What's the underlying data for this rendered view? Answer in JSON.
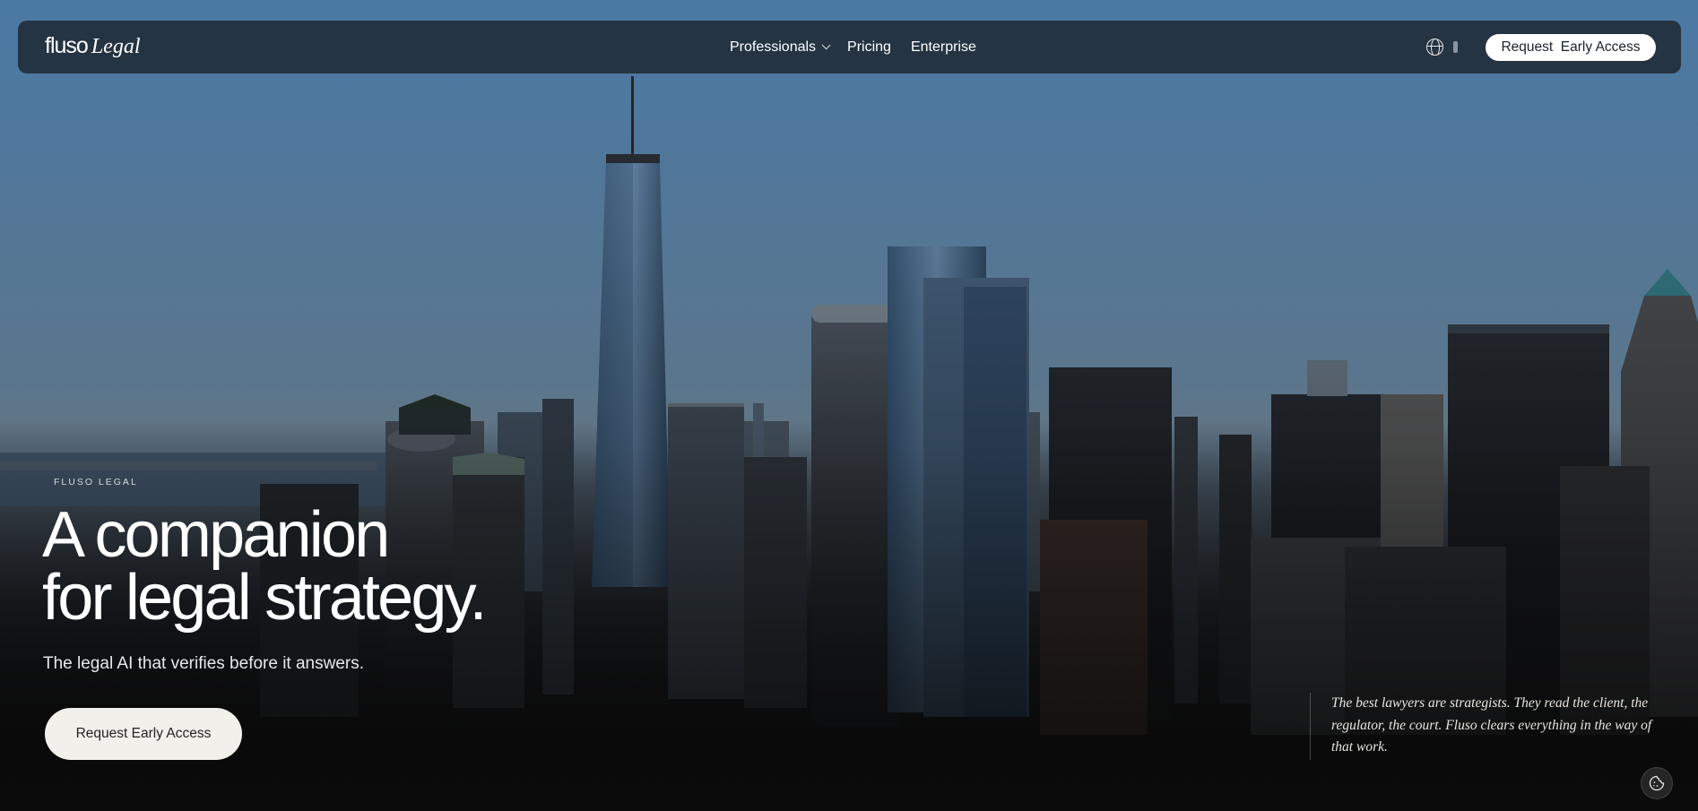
{
  "nav": {
    "logo_word": "fluso",
    "logo_legal": "Legal",
    "items": [
      {
        "label": "Professionals",
        "has_dropdown": true
      },
      {
        "label": "Pricing",
        "has_dropdown": false
      },
      {
        "label": "Enterprise",
        "has_dropdown": false
      }
    ],
    "language_icon": "globe-icon",
    "cta_label": "Request  Early Access"
  },
  "hero": {
    "eyebrow": "FLUSO LEGAL",
    "headline_line1": "A companion",
    "headline_line2": "for legal strategy.",
    "subhead": "The legal AI that verifies before it answers.",
    "cta_label": "Request Early Access"
  },
  "quote": {
    "text": "The best lawyers are strategists. They read the client, the regulator, the court. Fluso clears everything in the way of that work."
  },
  "cookie": {
    "icon": "cookie-icon"
  },
  "colors": {
    "nav_bg": "#202a36",
    "cta_light": "#f2f0ea",
    "sky": "#5d89b1",
    "text": "#ffffff"
  }
}
